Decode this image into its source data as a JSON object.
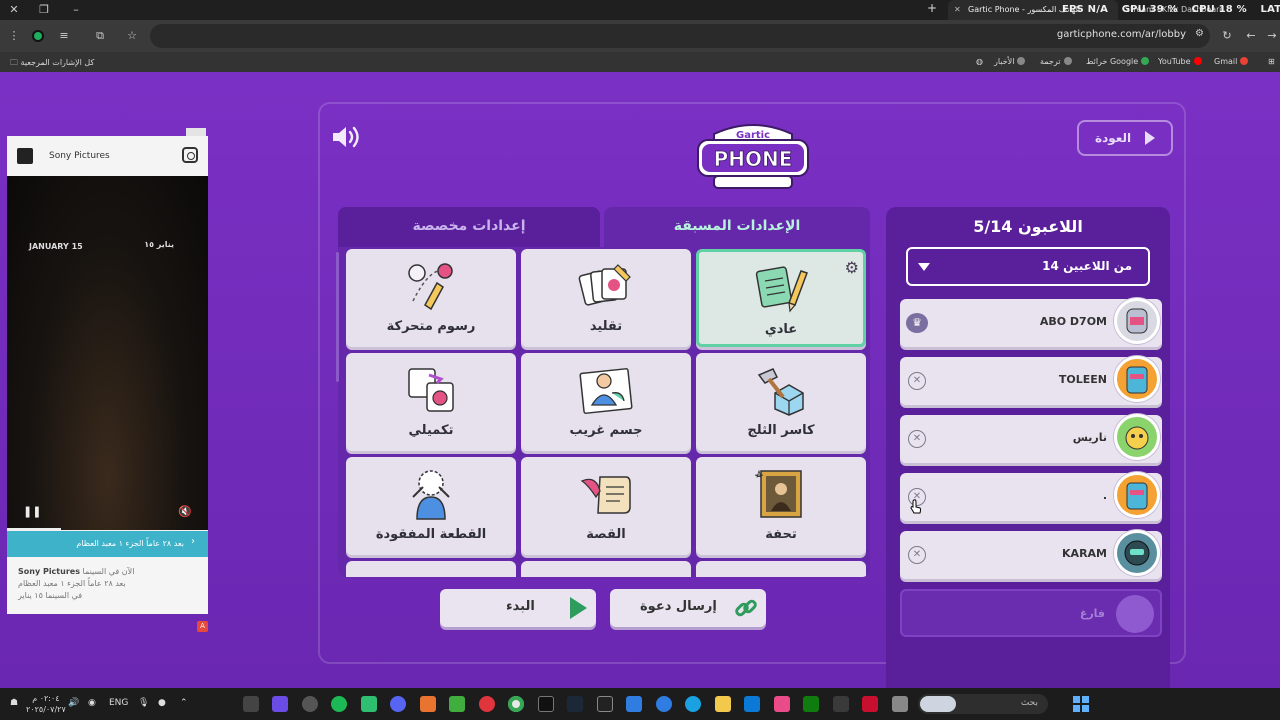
{
  "browser": {
    "tab_title": "Gartic Phone - الهاتف المكسور",
    "second_tab": "Stream - Kick Dashboard",
    "overlay": {
      "fps": "FPS N/A",
      "gpu": "GPU 39 %",
      "cpu": "CPU 18 %",
      "lat": "LAT N/A"
    },
    "url": "garticphone.com/ar/lobby",
    "bookmarks": {
      "all": "كل الإشارات المرجعية",
      "gmail": "Gmail",
      "youtube": "YouTube",
      "maps": "خرائط Google",
      "translate": "ترجمة",
      "news": "الأخبار"
    }
  },
  "ad": {
    "brand": "Sony Pictures",
    "video_left": "JANUARY 15",
    "video_right": "يناير ١٥",
    "bar_text": "بعد ٢٨ عاماً الجزء ١ معبد العظام",
    "foot_title": "Sony Pictures",
    "foot_line1": "الآن في السينما",
    "foot_line2": "بعد ٢٨ عاماً الجزء ١ معبد العظام",
    "foot_line3": "في السينما ١٥ يناير",
    "badge": "A"
  },
  "game": {
    "back_label": "العودة",
    "logo_top": "Gartic",
    "logo_main": "PHONE",
    "tab_presets": "الإعدادات المسبقة",
    "tab_custom": "إعدادات مخصصة",
    "modes": [
      {
        "label": "عادي"
      },
      {
        "label": "تقليد"
      },
      {
        "label": "رسوم متحركة"
      },
      {
        "label": "كاسر الثلج"
      },
      {
        "label": "جسم غريب"
      },
      {
        "label": "تكميلي"
      },
      {
        "label": "تحفة"
      },
      {
        "label": "القصة"
      },
      {
        "label": "القطعة المفقودة"
      }
    ],
    "start_label": "البدء",
    "invite_label": "إرسال دعوة",
    "players_title": "اللاعبون 5/14",
    "players_dropdown": "14 من اللاعبين",
    "players": [
      {
        "name": "ABO D7OM"
      },
      {
        "name": "TOLEEN"
      },
      {
        "name": "ناريس"
      },
      {
        "name": "."
      },
      {
        "name": "KARAM"
      }
    ],
    "empty_slot": "فارغ"
  },
  "taskbar": {
    "lang": "ENG",
    "time": "٠٢:٠٤ م",
    "date": "٢٠٢٥/٠٧/٢٧",
    "search": "بحث"
  },
  "colors": {
    "page_bg": "#7a30c4",
    "panel_bg": "#5a1f9b",
    "accent_green": "#5fd1a4",
    "card_bg": "#e7e1ee"
  }
}
